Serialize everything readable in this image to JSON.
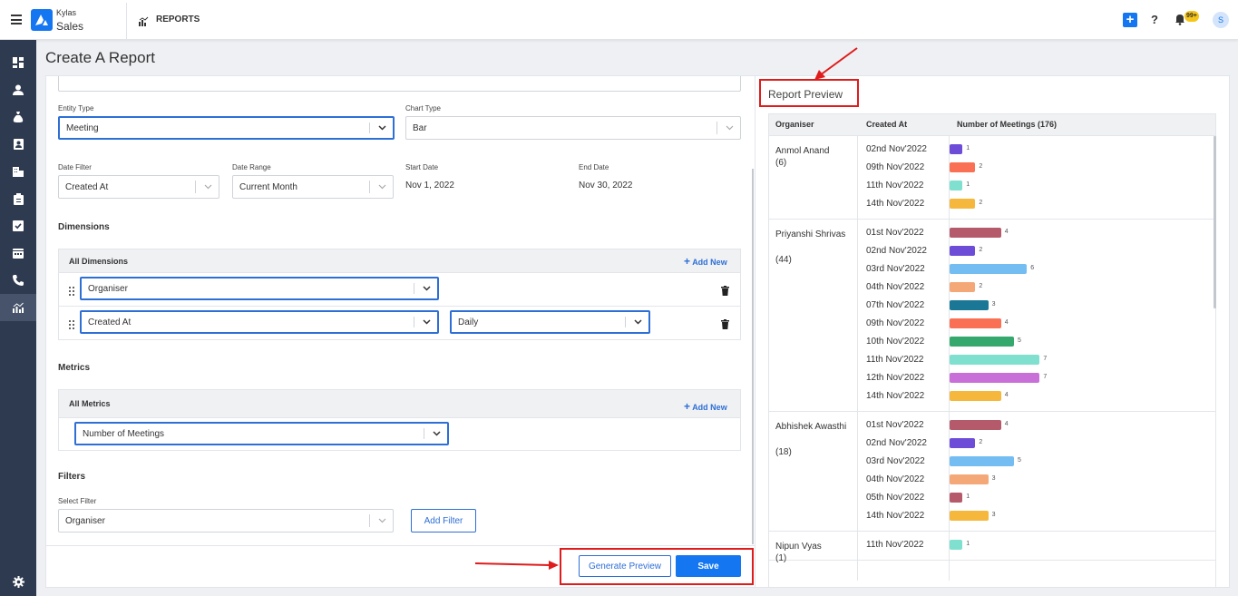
{
  "app": {
    "brand_line1": "Kylas",
    "brand_line2": "Sales",
    "module": "REPORTS",
    "notifications_badge": "99+",
    "avatar_initial": "S"
  },
  "page": {
    "title": "Create A Report"
  },
  "form": {
    "entity_type_label": "Entity Type",
    "entity_type_value": "Meeting",
    "chart_type_label": "Chart Type",
    "chart_type_value": "Bar",
    "date_filter_label": "Date Filter",
    "date_filter_value": "Created At",
    "date_range_label": "Date Range",
    "date_range_value": "Current Month",
    "start_date_label": "Start Date",
    "start_date_value": "Nov 1, 2022",
    "end_date_label": "End Date",
    "end_date_value": "Nov 30, 2022",
    "dimensions_title": "Dimensions",
    "all_dimensions": "All Dimensions",
    "add_new": "Add New",
    "dimension1": "Organiser",
    "dimension2": "Created At",
    "dimension2_grouping": "Daily",
    "metrics_title": "Metrics",
    "all_metrics": "All Metrics",
    "metric1": "Number of Meetings",
    "filters_title": "Filters",
    "select_filter_label": "Select Filter",
    "filter_value": "Organiser",
    "add_filter": "Add Filter",
    "generate_preview": "Generate Preview",
    "save": "Save"
  },
  "preview": {
    "title": "Report Preview",
    "col_organiser": "Organiser",
    "col_created_at": "Created At",
    "col_metric": "Number of Meetings (176)",
    "groups": [
      {
        "name": "Anmol Anand",
        "count": "(6)",
        "rows": [
          [
            "02nd Nov'2022",
            1,
            "#6d4cd8"
          ],
          [
            "09th Nov'2022",
            2,
            "#f97054"
          ],
          [
            "11th Nov'2022",
            1,
            "#7fe0cf"
          ],
          [
            "14th Nov'2022",
            2,
            "#f5b83d"
          ]
        ]
      },
      {
        "name": "Priyanshi Shrivas",
        "count": "(44)",
        "rows": [
          [
            "01st Nov'2022",
            4,
            "#b55a6b"
          ],
          [
            "02nd Nov'2022",
            2,
            "#6d4cd8"
          ],
          [
            "03rd Nov'2022",
            6,
            "#74bdf2"
          ],
          [
            "04th Nov'2022",
            2,
            "#f5a877"
          ],
          [
            "07th Nov'2022",
            3,
            "#1a7896"
          ],
          [
            "09th Nov'2022",
            4,
            "#f97054"
          ],
          [
            "10th Nov'2022",
            5,
            "#35a86e"
          ],
          [
            "11th Nov'2022",
            7,
            "#7fe0cf"
          ],
          [
            "12th Nov'2022",
            7,
            "#c870d8"
          ],
          [
            "14th Nov'2022",
            4,
            "#f5b83d"
          ]
        ]
      },
      {
        "name": "Abhishek Awasthi",
        "count": "(18)",
        "rows": [
          [
            "01st Nov'2022",
            4,
            "#b55a6b"
          ],
          [
            "02nd Nov'2022",
            2,
            "#6d4cd8"
          ],
          [
            "03rd Nov'2022",
            5,
            "#74bdf2"
          ],
          [
            "04th Nov'2022",
            3,
            "#f5a877"
          ],
          [
            "05th Nov'2022",
            1,
            "#b55a6b"
          ],
          [
            "14th Nov'2022",
            3,
            "#f5b83d"
          ]
        ]
      },
      {
        "name": "Nipun Vyas",
        "count": "(1)",
        "rows": [
          [
            "11th Nov'2022",
            1,
            "#7fe0cf"
          ]
        ]
      }
    ]
  },
  "colors": {
    "accent": "#2e6fd6",
    "primary_button": "#1476f0",
    "sidebar": "#2e3a4f",
    "annotation_red": "#e01b1b"
  }
}
